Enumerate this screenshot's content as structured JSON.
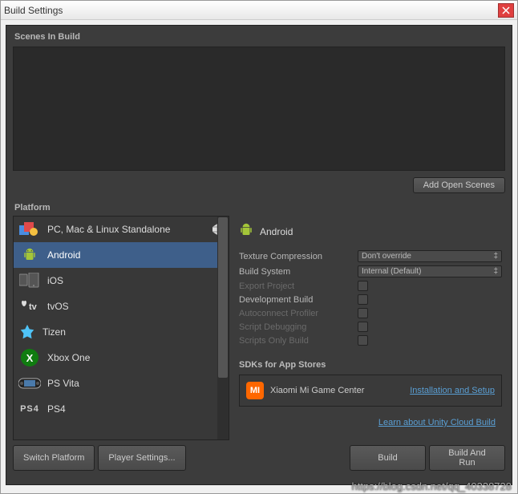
{
  "window": {
    "title": "Build Settings"
  },
  "scenes": {
    "label": "Scenes In Build"
  },
  "buttons": {
    "add_open_scenes": "Add Open Scenes",
    "switch_platform": "Switch Platform",
    "player_settings": "Player Settings...",
    "build": "Build",
    "build_and_run": "Build And Run"
  },
  "platform": {
    "label": "Platform",
    "items": [
      {
        "label": "PC, Mac & Linux Standalone",
        "current": true
      },
      {
        "label": "Android"
      },
      {
        "label": "iOS"
      },
      {
        "label": "tvOS"
      },
      {
        "label": "Tizen"
      },
      {
        "label": "Xbox One"
      },
      {
        "label": "PS Vita"
      },
      {
        "label": "PS4"
      }
    ],
    "selected_index": 1
  },
  "detail": {
    "title": "Android",
    "settings": {
      "texture_compression": {
        "label": "Texture Compression",
        "value": "Don't override"
      },
      "build_system": {
        "label": "Build System",
        "value": "Internal (Default)"
      },
      "export_project": {
        "label": "Export Project",
        "checked": false,
        "disabled": true
      },
      "development_build": {
        "label": "Development Build",
        "checked": false
      },
      "autoconnect_profiler": {
        "label": "Autoconnect Profiler",
        "checked": false,
        "disabled": true
      },
      "script_debugging": {
        "label": "Script Debugging",
        "checked": false,
        "disabled": true
      },
      "scripts_only_build": {
        "label": "Scripts Only Build",
        "checked": false,
        "disabled": true
      }
    },
    "sdk": {
      "label": "SDKs for App Stores",
      "xiaomi": "Xiaomi Mi Game Center",
      "install_link": "Installation and Setup"
    },
    "cloud_link": "Learn about Unity Cloud Build"
  },
  "watermark": "https://blog.csdn.net/qq_40338728"
}
